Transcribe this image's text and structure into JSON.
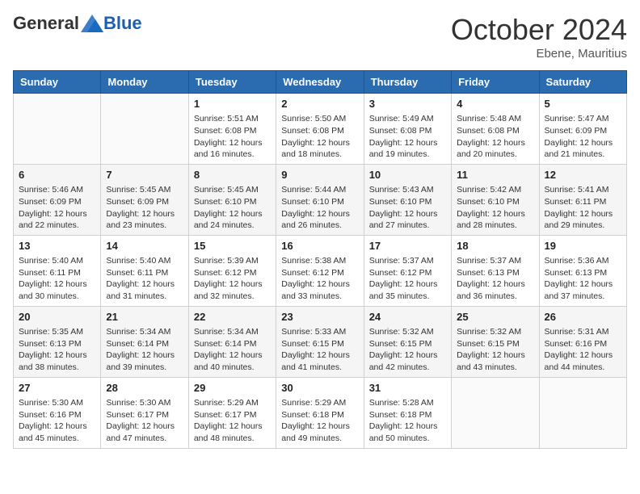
{
  "header": {
    "logo_general": "General",
    "logo_blue": "Blue",
    "month_title": "October 2024",
    "location": "Ebene, Mauritius"
  },
  "weekdays": [
    "Sunday",
    "Monday",
    "Tuesday",
    "Wednesday",
    "Thursday",
    "Friday",
    "Saturday"
  ],
  "rows": [
    [
      {
        "day": "",
        "info": ""
      },
      {
        "day": "",
        "info": ""
      },
      {
        "day": "1",
        "info": "Sunrise: 5:51 AM\nSunset: 6:08 PM\nDaylight: 12 hours and 16 minutes."
      },
      {
        "day": "2",
        "info": "Sunrise: 5:50 AM\nSunset: 6:08 PM\nDaylight: 12 hours and 18 minutes."
      },
      {
        "day": "3",
        "info": "Sunrise: 5:49 AM\nSunset: 6:08 PM\nDaylight: 12 hours and 19 minutes."
      },
      {
        "day": "4",
        "info": "Sunrise: 5:48 AM\nSunset: 6:08 PM\nDaylight: 12 hours and 20 minutes."
      },
      {
        "day": "5",
        "info": "Sunrise: 5:47 AM\nSunset: 6:09 PM\nDaylight: 12 hours and 21 minutes."
      }
    ],
    [
      {
        "day": "6",
        "info": "Sunrise: 5:46 AM\nSunset: 6:09 PM\nDaylight: 12 hours and 22 minutes."
      },
      {
        "day": "7",
        "info": "Sunrise: 5:45 AM\nSunset: 6:09 PM\nDaylight: 12 hours and 23 minutes."
      },
      {
        "day": "8",
        "info": "Sunrise: 5:45 AM\nSunset: 6:10 PM\nDaylight: 12 hours and 24 minutes."
      },
      {
        "day": "9",
        "info": "Sunrise: 5:44 AM\nSunset: 6:10 PM\nDaylight: 12 hours and 26 minutes."
      },
      {
        "day": "10",
        "info": "Sunrise: 5:43 AM\nSunset: 6:10 PM\nDaylight: 12 hours and 27 minutes."
      },
      {
        "day": "11",
        "info": "Sunrise: 5:42 AM\nSunset: 6:10 PM\nDaylight: 12 hours and 28 minutes."
      },
      {
        "day": "12",
        "info": "Sunrise: 5:41 AM\nSunset: 6:11 PM\nDaylight: 12 hours and 29 minutes."
      }
    ],
    [
      {
        "day": "13",
        "info": "Sunrise: 5:40 AM\nSunset: 6:11 PM\nDaylight: 12 hours and 30 minutes."
      },
      {
        "day": "14",
        "info": "Sunrise: 5:40 AM\nSunset: 6:11 PM\nDaylight: 12 hours and 31 minutes."
      },
      {
        "day": "15",
        "info": "Sunrise: 5:39 AM\nSunset: 6:12 PM\nDaylight: 12 hours and 32 minutes."
      },
      {
        "day": "16",
        "info": "Sunrise: 5:38 AM\nSunset: 6:12 PM\nDaylight: 12 hours and 33 minutes."
      },
      {
        "day": "17",
        "info": "Sunrise: 5:37 AM\nSunset: 6:12 PM\nDaylight: 12 hours and 35 minutes."
      },
      {
        "day": "18",
        "info": "Sunrise: 5:37 AM\nSunset: 6:13 PM\nDaylight: 12 hours and 36 minutes."
      },
      {
        "day": "19",
        "info": "Sunrise: 5:36 AM\nSunset: 6:13 PM\nDaylight: 12 hours and 37 minutes."
      }
    ],
    [
      {
        "day": "20",
        "info": "Sunrise: 5:35 AM\nSunset: 6:13 PM\nDaylight: 12 hours and 38 minutes."
      },
      {
        "day": "21",
        "info": "Sunrise: 5:34 AM\nSunset: 6:14 PM\nDaylight: 12 hours and 39 minutes."
      },
      {
        "day": "22",
        "info": "Sunrise: 5:34 AM\nSunset: 6:14 PM\nDaylight: 12 hours and 40 minutes."
      },
      {
        "day": "23",
        "info": "Sunrise: 5:33 AM\nSunset: 6:15 PM\nDaylight: 12 hours and 41 minutes."
      },
      {
        "day": "24",
        "info": "Sunrise: 5:32 AM\nSunset: 6:15 PM\nDaylight: 12 hours and 42 minutes."
      },
      {
        "day": "25",
        "info": "Sunrise: 5:32 AM\nSunset: 6:15 PM\nDaylight: 12 hours and 43 minutes."
      },
      {
        "day": "26",
        "info": "Sunrise: 5:31 AM\nSunset: 6:16 PM\nDaylight: 12 hours and 44 minutes."
      }
    ],
    [
      {
        "day": "27",
        "info": "Sunrise: 5:30 AM\nSunset: 6:16 PM\nDaylight: 12 hours and 45 minutes."
      },
      {
        "day": "28",
        "info": "Sunrise: 5:30 AM\nSunset: 6:17 PM\nDaylight: 12 hours and 47 minutes."
      },
      {
        "day": "29",
        "info": "Sunrise: 5:29 AM\nSunset: 6:17 PM\nDaylight: 12 hours and 48 minutes."
      },
      {
        "day": "30",
        "info": "Sunrise: 5:29 AM\nSunset: 6:18 PM\nDaylight: 12 hours and 49 minutes."
      },
      {
        "day": "31",
        "info": "Sunrise: 5:28 AM\nSunset: 6:18 PM\nDaylight: 12 hours and 50 minutes."
      },
      {
        "day": "",
        "info": ""
      },
      {
        "day": "",
        "info": ""
      }
    ]
  ]
}
